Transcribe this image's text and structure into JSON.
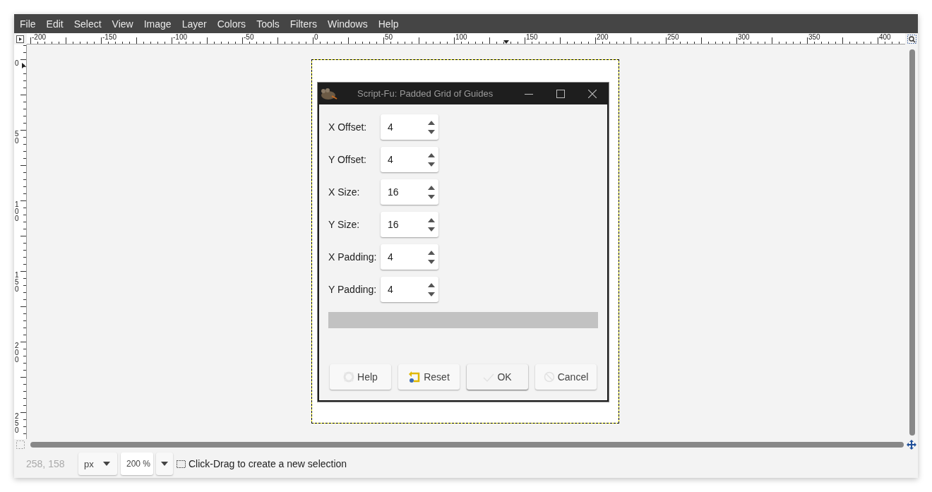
{
  "menu": [
    "File",
    "Edit",
    "Select",
    "View",
    "Image",
    "Layer",
    "Colors",
    "Tools",
    "Filters",
    "Windows",
    "Help"
  ],
  "rulers": {
    "horizontal": [
      "-200",
      "-150",
      "-100",
      "-50",
      "0",
      "50",
      "100",
      "150",
      "200",
      "250",
      "300",
      "350",
      "400"
    ],
    "vertical": [
      "0",
      "50",
      "100",
      "150",
      "200",
      "250"
    ]
  },
  "dialog": {
    "title": "Script-Fu: Padded Grid of Guides",
    "fields": [
      {
        "label": "X Offset:",
        "value": "4"
      },
      {
        "label": "Y Offset:",
        "value": "4"
      },
      {
        "label": "X Size:",
        "value": "16"
      },
      {
        "label": "Y Size:",
        "value": "16"
      },
      {
        "label": "X Padding:",
        "value": "4"
      },
      {
        "label": "Y Padding:",
        "value": "4"
      }
    ],
    "progress": {
      "level": 0
    },
    "buttons": [
      {
        "label": "Help",
        "kind": "help",
        "default": false
      },
      {
        "label": "Reset",
        "kind": "reset",
        "default": false
      },
      {
        "label": "OK",
        "kind": "ok",
        "default": true
      },
      {
        "label": "Cancel",
        "kind": "cancel",
        "default": false
      }
    ]
  },
  "status": {
    "coords": "258, 158",
    "unit": "px",
    "zoom": "200 %",
    "message": "Click-Drag to create a new selection"
  }
}
